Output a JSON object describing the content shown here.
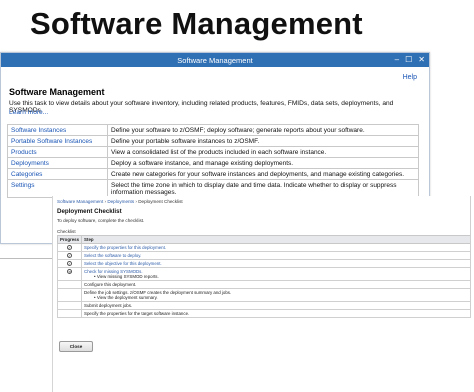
{
  "slide": {
    "title": "Software Management"
  },
  "window1": {
    "title": "Software Management",
    "controls": [
      "–",
      "☐",
      "✕"
    ],
    "help": "Help",
    "heading": "Software Management",
    "description": "Use this task to view details about your software inventory, including related products, features, FMIDs, data sets, deployments, and SYSMODs.",
    "learn_more": "Learn more...",
    "rows": [
      {
        "name": "Software Instances",
        "desc": "Define your software to z/OSMF; deploy software; generate reports about your software."
      },
      {
        "name": "Portable Software Instances",
        "desc": "Define your portable software instances to z/OSMF."
      },
      {
        "name": "Products",
        "desc": "View a consolidated list of the products included in each software instance."
      },
      {
        "name": "Deployments",
        "desc": "Deploy a software instance, and manage existing deployments."
      },
      {
        "name": "Categories",
        "desc": "Create new categories for your software instances and deployments, and manage existing categories."
      },
      {
        "name": "Settings",
        "desc": "Select the time zone in which to display date and time data. Indicate whether to display or suppress information messages."
      }
    ]
  },
  "window2": {
    "breadcrumb": [
      "Software Management",
      "Deployments",
      "Deployment Checklist"
    ],
    "title": "Deployment Checklist",
    "subtitle": "To deploy software, complete the checklist.",
    "checklist_label": "Checklist",
    "columns": [
      "Progress",
      "Step"
    ],
    "steps": [
      {
        "status": "done",
        "text": "Specify the properties for this deployment.",
        "link": true,
        "sub": ""
      },
      {
        "status": "done",
        "text": "Select the software to deploy.",
        "link": true,
        "sub": ""
      },
      {
        "status": "done",
        "text": "Select the objective for this deployment.",
        "link": true,
        "sub": ""
      },
      {
        "status": "current",
        "text": "Check for missing SYSMODs.",
        "link": true,
        "sub": "View missing SYSMOD reports."
      },
      {
        "status": "",
        "text": "Configure this deployment.",
        "link": false,
        "sub": ""
      },
      {
        "status": "",
        "text": "Define the job settings. z/OSMF creates the deployment summary and jobs.",
        "link": false,
        "sub": "View the deployment summary."
      },
      {
        "status": "",
        "text": "Submit deployment jobs.",
        "link": false,
        "sub": ""
      },
      {
        "status": "",
        "text": "Specify the properties for the target software instance.",
        "link": false,
        "sub": ""
      }
    ],
    "close_label": "Close"
  }
}
